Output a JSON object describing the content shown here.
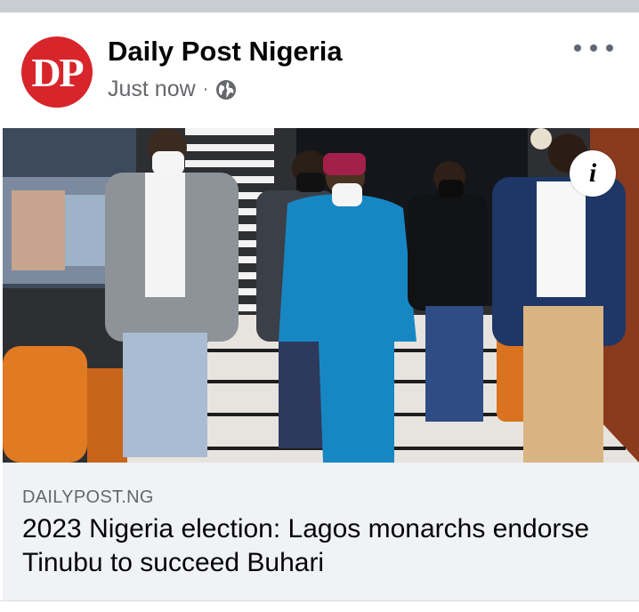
{
  "post": {
    "page_name": "Daily Post Nigeria",
    "avatar_text": "DP",
    "timestamp": "Just now",
    "separator": "·",
    "privacy_icon": "globe-icon",
    "more_icon": "more-options-icon"
  },
  "image": {
    "info_icon": "info-icon",
    "info_letter": "i"
  },
  "link": {
    "domain": "DAILYPOST.NG",
    "headline": "2023 Nigeria election: Lagos monarchs endorse Tinubu to succeed Buhari"
  },
  "colors": {
    "brand_red": "#d7252b",
    "preview_bg": "#f0f2f5",
    "meta_gray": "#65676b",
    "top_strip": "#c9ccd1"
  }
}
